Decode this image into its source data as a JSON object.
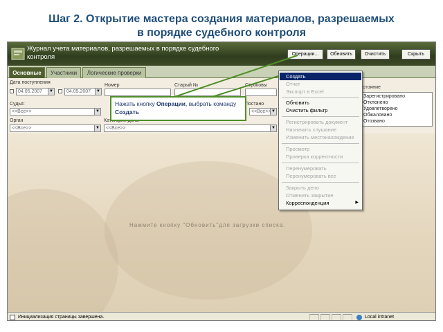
{
  "slide": {
    "title_line1": "Шаг 2. Открытие мастера создания материалов, разрешаемых",
    "title_line2": "в порядке судебного контроля"
  },
  "app": {
    "title_line1": "Журнал учета материалов, разрешаемых в порядке судебного",
    "title_line2": "контроля",
    "buttons": {
      "operations": "Операции...",
      "refresh": "Обновить",
      "clear": "Очистить",
      "hide": "Скрыть"
    }
  },
  "tabs": [
    {
      "label": "Основные"
    },
    {
      "label": "Участники"
    },
    {
      "label": "Логические проверки"
    }
  ],
  "filters": {
    "date_label": "Дата поступления",
    "date_from": "04.05.2007",
    "date_to": "04.05.2007",
    "number_label": "Номер",
    "old_number_label": "Старый №",
    "judge_label": "Судья:",
    "judge_value": "<<Все>>",
    "organ_label": "Орган",
    "organ_value": "<<Все>>",
    "category_label": "Категория дела",
    "category_value": "<<Все>>",
    "storage_label": "Строковы",
    "rest_label": "Постано",
    "rest_value": "<<Все>>",
    "status_label": "Состояние",
    "statuses": [
      "Зарегистрировано",
      "Отклонено",
      "Удовлетворено",
      "Обжаловано",
      "Отозвано"
    ]
  },
  "content": {
    "hint": "Нажмите кнопку \"Обновить\"для загрузки списка."
  },
  "menu": {
    "items": [
      {
        "label": "Создать",
        "state": "highlight"
      },
      {
        "label": "Отчет",
        "state": "disabled"
      },
      {
        "label": "Экспорт в Excel",
        "state": "disabled"
      },
      {
        "label": "Обновить",
        "state": "enabled"
      },
      {
        "label": "Очистить фильтр",
        "state": "enabled"
      },
      {
        "label": "Регистрировать документ",
        "state": "disabled"
      },
      {
        "label": "Назначить слушание",
        "state": "disabled"
      },
      {
        "label": "Изменить местонахождение",
        "state": "disabled"
      },
      {
        "label": "Просмотр",
        "state": "disabled"
      },
      {
        "label": "Проверка корректности",
        "state": "disabled"
      },
      {
        "label": "Перенумеровать",
        "state": "disabled"
      },
      {
        "label": "Перенумеровать все",
        "state": "disabled"
      },
      {
        "label": "Закрыть дело",
        "state": "disabled"
      },
      {
        "label": "Отменить закрытие",
        "state": "disabled"
      },
      {
        "label": "Корреспонденция",
        "state": "enabled"
      }
    ]
  },
  "callout": {
    "prefix": "Нажать кнопку ",
    "bold1": "Операции",
    "middle": ", выбрать команду ",
    "bold2": "Создать"
  },
  "statusbar": {
    "text": "Инициализация страницы завершена.",
    "zone": "Local intranet"
  },
  "colors": {
    "title": "#1f4e79",
    "header_bg": "#2f3d1e",
    "menu_highlight": "#0a246a",
    "callout_border": "#4e8f27"
  }
}
